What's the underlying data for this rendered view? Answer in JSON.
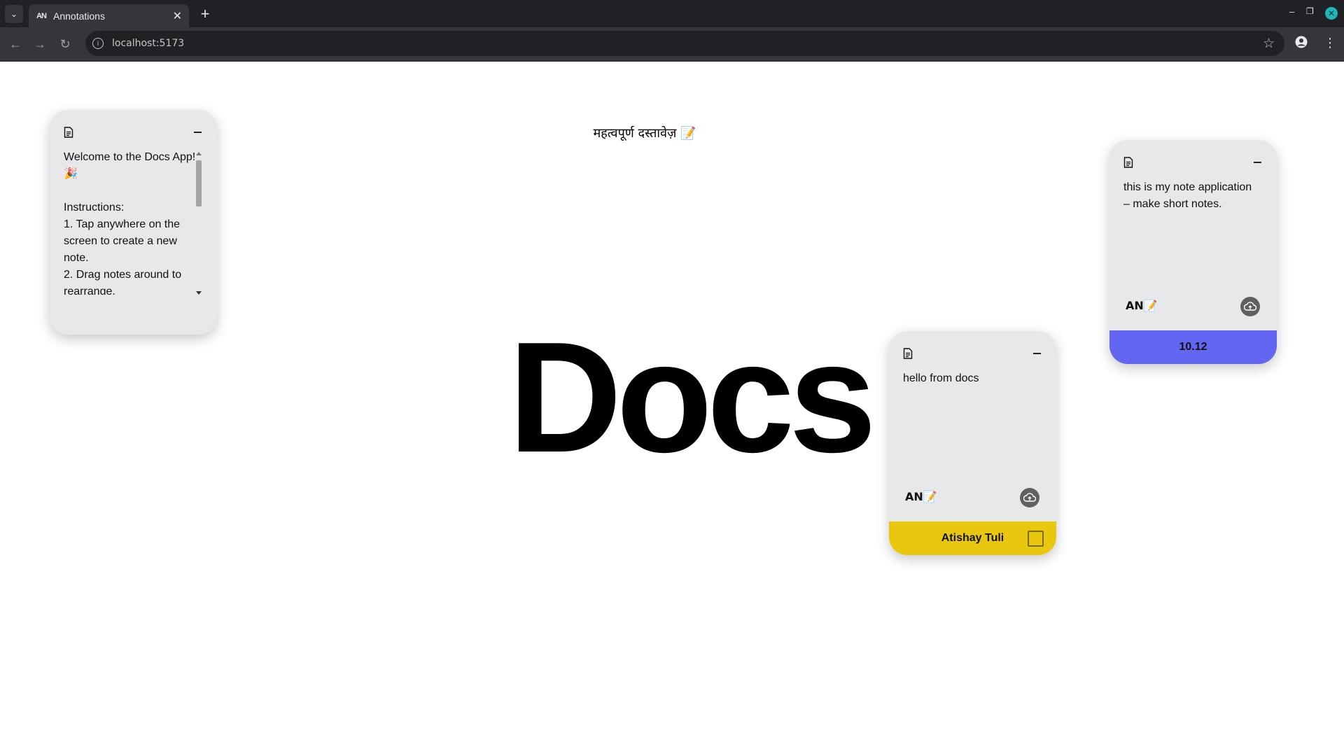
{
  "browser": {
    "tab_title": "Annotations",
    "tab_favicon": "AN",
    "url": "localhost:5173"
  },
  "page": {
    "heading": "महत्वपूर्ण दस्तावेज़ 📝",
    "hero_title": "Docs"
  },
  "notes": [
    {
      "text": "Welcome to the Docs App! 🎉\n\nInstructions:\n1. Tap anywhere on the screen to create a new note.\n2. Drag notes around to rearrange."
    },
    {
      "text": "this is my note application – make short notes.",
      "author": "AN📝",
      "footer": "10.12",
      "footer_color": "#6366f1"
    },
    {
      "text": "hello from docs",
      "author": "AN📝",
      "footer": "Atishay Tuli",
      "footer_color": "#eac70f"
    }
  ]
}
